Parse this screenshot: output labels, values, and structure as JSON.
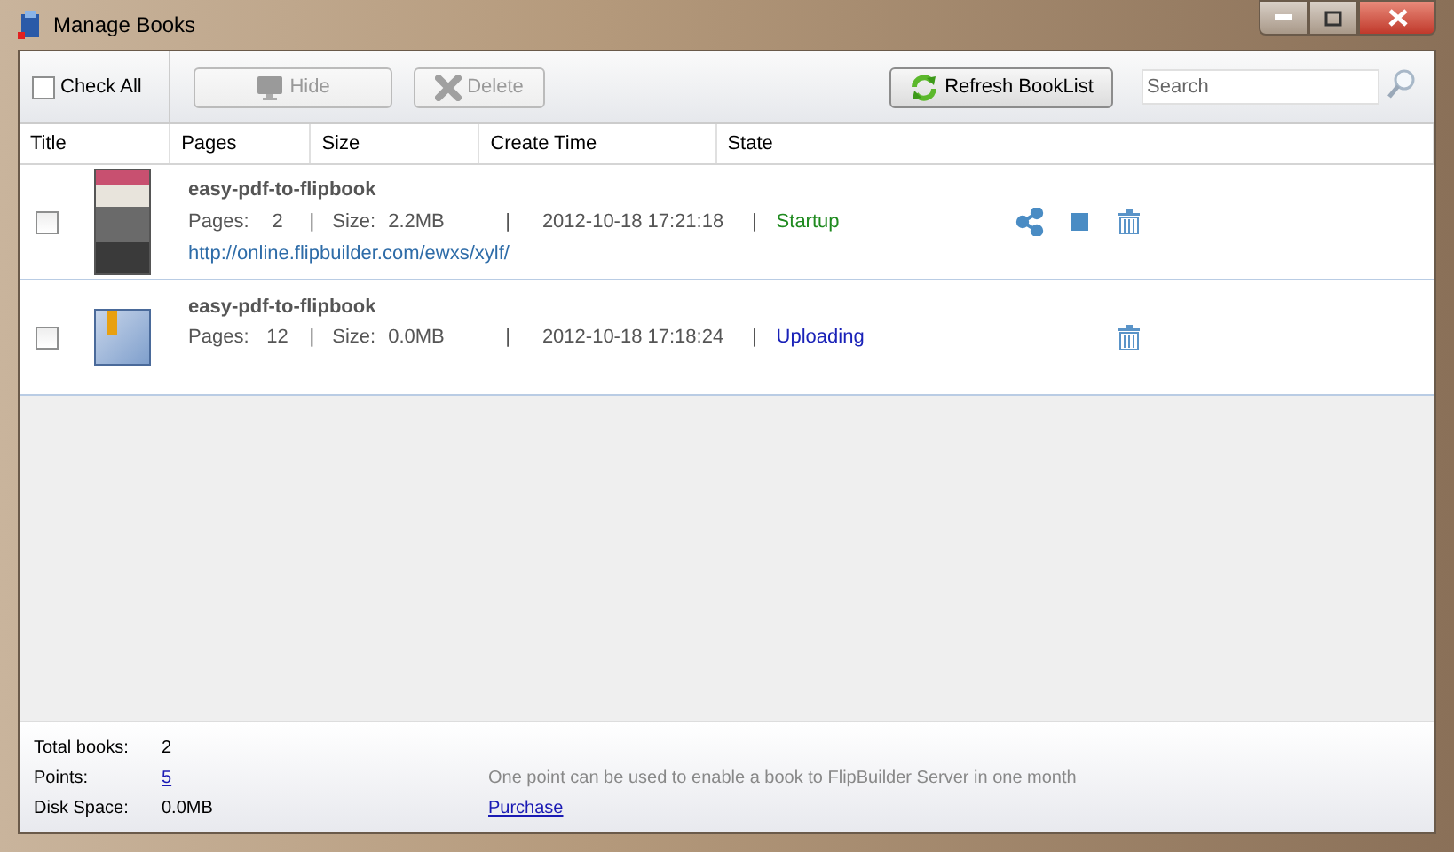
{
  "window": {
    "title": "Manage Books"
  },
  "toolbar": {
    "check_all": {
      "label": "Check All",
      "checked": false
    },
    "buttons": [
      {
        "kind": "hide",
        "label": "Hide",
        "disabled": true
      },
      {
        "kind": "delete",
        "label": "Delete",
        "disabled": true
      },
      {
        "kind": "refresh",
        "label": "Refresh BookList",
        "disabled": false
      }
    ],
    "search": {
      "placeholder": "Search"
    }
  },
  "table": {
    "columns": [
      "Title",
      "Pages",
      "Size",
      "Create Time",
      "State"
    ],
    "rows": [
      {
        "checked": false,
        "cover": {
          "kind": "magazine"
        },
        "title": "easy-pdf-to-flipbook",
        "pages_label": "Pages:",
        "pages": "2",
        "size_label": "Size:",
        "size": "2.2MB",
        "created": "2012-10-18 17:21:18",
        "separator": "|",
        "state": {
          "text": "Startup",
          "color": "#1f8a1f"
        },
        "url": "http://online.flipbuilder.com/ewxs/xylf/",
        "actions": [
          {
            "kind": "share"
          },
          {
            "kind": "stop"
          },
          {
            "kind": "delete"
          }
        ]
      },
      {
        "checked": false,
        "cover": {
          "kind": "blank"
        },
        "title": "easy-pdf-to-flipbook",
        "pages_label": "Pages:",
        "pages": "12",
        "size_label": "Size:",
        "size": "0.0MB",
        "created": "2012-10-18 17:18:24",
        "separator": "|",
        "state": {
          "text": "Uploading",
          "color": "#1a22b8"
        },
        "actions": [
          {
            "kind": "delete"
          }
        ]
      }
    ]
  },
  "footer": {
    "stats": [
      {
        "label": "Total books:",
        "value": "2",
        "link": false
      },
      {
        "label": "Points:",
        "value": "5",
        "link": true
      },
      {
        "label": "Disk Space:",
        "value": "0.0MB",
        "link": false
      }
    ],
    "note": "One point can be used to enable a book to FlipBuilder Server in one month",
    "purchase": "Purchase"
  }
}
